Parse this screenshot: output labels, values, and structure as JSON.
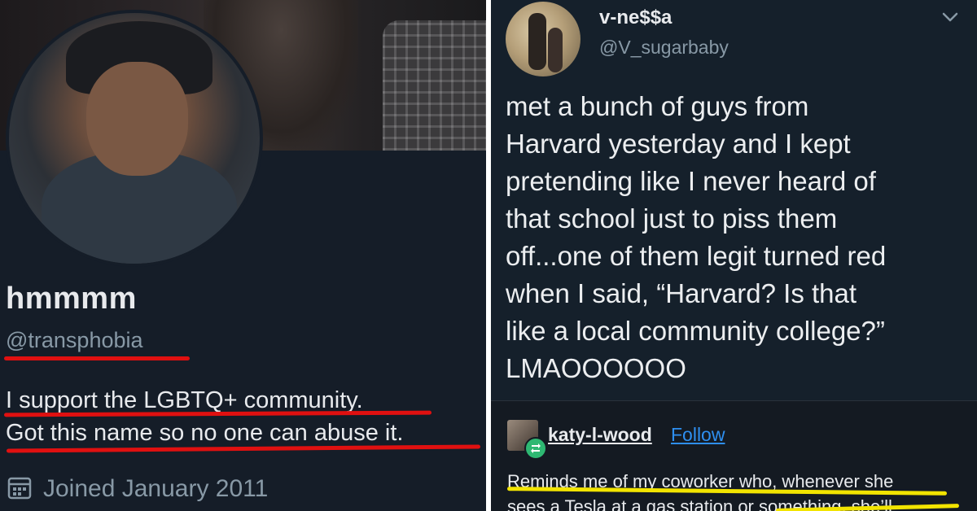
{
  "left_post": {
    "display_name": "hmmmm",
    "handle": "@transphobia",
    "bio_line1": "I support the LGBTQ+ community.",
    "bio_line2": "Got this name so no one can abuse it.",
    "joined": "Joined January 2011",
    "underline_color": "#e01010"
  },
  "right_post": {
    "author_name": "v-ne$$a",
    "author_handle": "@V_sugarbaby",
    "tweet_text": "met a bunch of guys from\nHarvard yesterday and I kept\npretending like I never heard of\nthat school just to piss them\noff...one of them legit turned red\nwhen I said, “Harvard? Is that\nlike a local community college?”\nLMAOOOOOO",
    "reblogger": "katy-l-wood",
    "follow_label": "Follow",
    "reply_line1": "Reminds me of my coworker who, whenever she",
    "reply_line2": "sees a Tesla at a gas station or something, she’ll",
    "underline_color": "#f2e400",
    "link_color": "#2e8ff0",
    "reblog_badge_color": "#2eb872"
  },
  "icons": [
    "calendar-icon",
    "chevron-down-icon",
    "reblog-icon"
  ]
}
